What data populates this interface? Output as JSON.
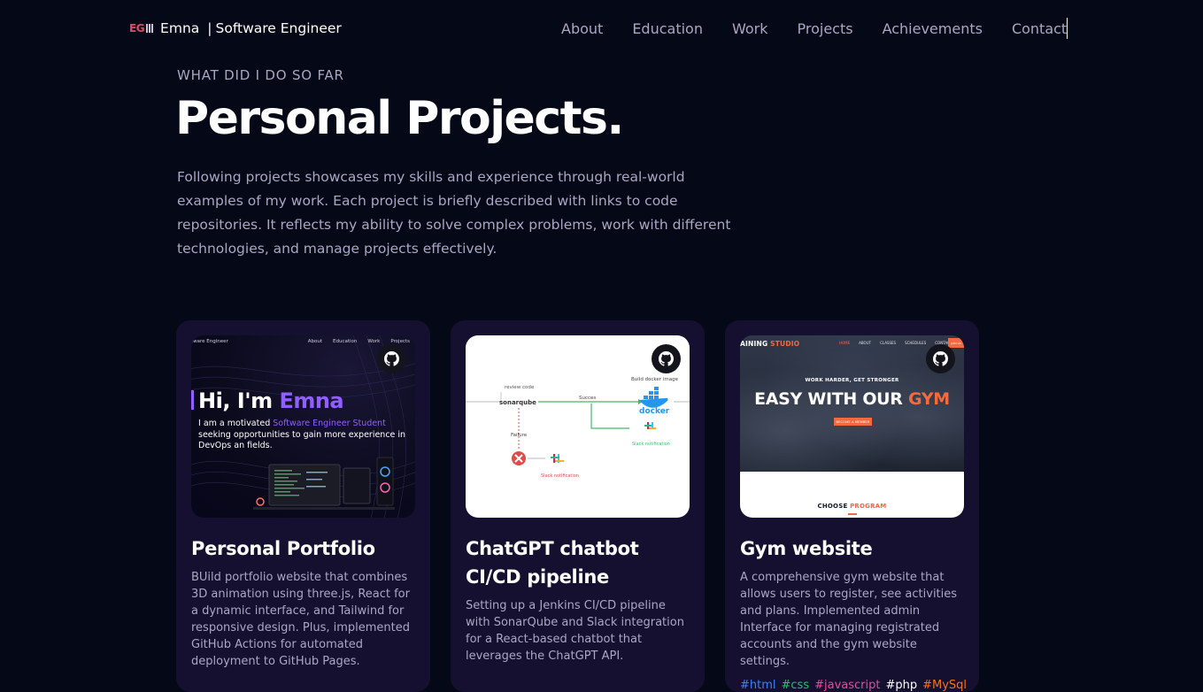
{
  "nav": {
    "logo_text": "EG",
    "brand_name": "Emna",
    "brand_separator": "|",
    "brand_role": "Software Engineer",
    "links": [
      "About",
      "Education",
      "Work",
      "Projects",
      "Achievements",
      "Contact"
    ]
  },
  "hero": {
    "subtitle": "What did I do so far",
    "title": "Personal Projects.",
    "intro": "Following projects showcases my skills and experience through real-world examples of my work. Each project is briefly described with links to code repositories. It reflects my ability to solve complex problems, work with different technologies, and manage projects effectively."
  },
  "projects": [
    {
      "title": "Personal Portfolio",
      "description": "BUild portfolio website that combines 3D animation using three.js, React for a dynamic interface, and Tailwind for responsive design. Plus, implemented GitHub Actions for automated deployment to GitHub Pages.",
      "thumb": {
        "nav_brand": "tware Engineer",
        "nav_links": [
          "About",
          "Education",
          "Work",
          "Projects"
        ],
        "greeting": "Hi, I'm",
        "greeting_name": "Emna",
        "line_1_prefix": "I am a motivated",
        "line_1_accent": "Software Engineer Student",
        "line_1_suffix": "seeking opportunities to gain more experience in DevOps an fields."
      },
      "tags": []
    },
    {
      "title": "ChatGPT chatbot CI/CD pipeline",
      "description": "Setting up a Jenkins CI/CD pipeline with SonarQube and Slack integration for a React-based chatbot that leverages the ChatGPT API.",
      "thumb": {
        "review_code": "review code",
        "sonarqube": "sonarqube",
        "success": "Succes",
        "build_docker": "Build docker image",
        "docker": "docker",
        "slack_ok": "Slack notification",
        "failure": "Failure",
        "slack_fail": "Slack notification"
      },
      "tags": []
    },
    {
      "title": "Gym website",
      "description": "A comprehensive gym website that allows users to register, see activities and plans. Implemented admin Interface for managing registrated accounts and the gym website settings.",
      "thumb": {
        "brand_prefix": "AINING",
        "brand_accent": "STUDIO",
        "links": [
          "HOME",
          "ABOUT",
          "CLASSES",
          "SCHEDULES",
          "CONTACT"
        ],
        "cta": "JOIN US",
        "kicker": "WORK HARDER, GET STRONGER",
        "headline_prefix": "EASY WITH OUR",
        "headline_accent": "GYM",
        "member_button": "BECOME A MEMBER",
        "choose_prefix": "CHOOSE",
        "choose_accent": "PROGRAM"
      },
      "tags": [
        {
          "label": "#html",
          "color": "#3b82f6"
        },
        {
          "label": "#css",
          "color": "#22c55e"
        },
        {
          "label": "#javascript",
          "color": "#ec4899"
        },
        {
          "label": "#php",
          "color": "#ffffff"
        },
        {
          "label": "#MySql",
          "color": "#f97316"
        }
      ]
    }
  ],
  "colors": {
    "background": "#050816",
    "card": "#151030",
    "secondary_text": "#aaa6c3",
    "accent_purple": "#915eff",
    "gym_orange": "#f36a3f"
  },
  "icons": {
    "github": "github-icon"
  }
}
